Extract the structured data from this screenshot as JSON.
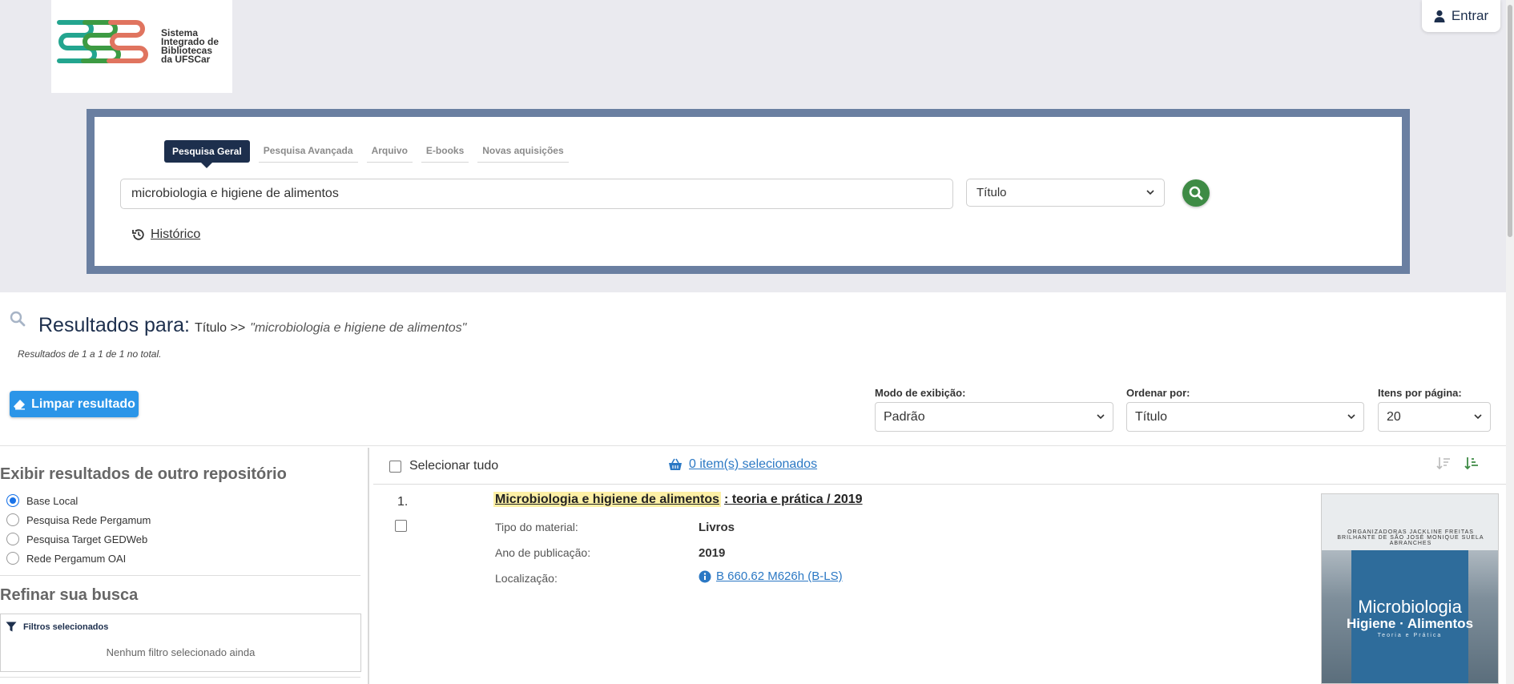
{
  "logo": {
    "line1": "Sistema",
    "line2": "Integrado de",
    "line3": "Bibliotecas",
    "line4": "da UFSCar"
  },
  "header": {
    "login_label": "Entrar"
  },
  "search": {
    "tabs": [
      {
        "label": "Pesquisa Geral",
        "active": true
      },
      {
        "label": "Pesquisa Avançada",
        "active": false
      },
      {
        "label": "Arquivo",
        "active": false
      },
      {
        "label": "E-books",
        "active": false
      },
      {
        "label": "Novas aquisições",
        "active": false
      }
    ],
    "query": "microbiologia e higiene de alimentos",
    "field": "Título",
    "history_label": "Histórico"
  },
  "results": {
    "title": "Resultados para:",
    "field": "Título >>",
    "query": "\"microbiologia e higiene de alimentos\"",
    "count_text": "Resultados de 1 a 1 de 1 no total.",
    "clear_label": "Limpar resultado"
  },
  "controls": {
    "view_label": "Modo de exibição:",
    "view_value": "Padrão",
    "order_label": "Ordenar por:",
    "order_value": "Título",
    "per_page_label": "Itens por página:",
    "per_page_value": "20"
  },
  "sidebar": {
    "repo_heading": "Exibir resultados de outro repositório",
    "repos": [
      {
        "label": "Base Local",
        "selected": true
      },
      {
        "label": "Pesquisa Rede Pergamum",
        "selected": false
      },
      {
        "label": "Pesquisa Target GEDWeb",
        "selected": false
      },
      {
        "label": "Rede Pergamum OAI",
        "selected": false
      }
    ],
    "refine_heading": "Refinar sua busca",
    "filters_label": "Filtros selecionados",
    "no_filters": "Nenhum filtro selecionado ainda"
  },
  "toolbar": {
    "select_all": "Selecionar tudo",
    "selected_count": "0 item(s) selecionados"
  },
  "items": [
    {
      "number": "1.",
      "title_highlight": "Microbiologia e higiene de alimentos",
      "title_rest": ": teoria e prática / 2019",
      "fields": [
        {
          "label": "Tipo do material:",
          "value": "Livros"
        },
        {
          "label": "Ano de publicação:",
          "value": "2019"
        },
        {
          "label": "Localização:",
          "value": "B 660.62 M626h (B-LS)"
        }
      ],
      "cover": {
        "credits": "ORGANIZADORAS JACKLINE FREITAS BRILHANTE DE SÃO JOSÉ MONIQUE SUELA ABRANCHES",
        "title1": "Microbiologia",
        "title2": "Higiene · Alimentos",
        "title3": "Teoria e Prática"
      }
    }
  ],
  "colors": {
    "navy": "#1d2f4d",
    "frame": "#6a7fa1",
    "accent_blue": "#2b95e8",
    "go_green": "#3e8b45",
    "highlight": "#fdf0a6"
  }
}
